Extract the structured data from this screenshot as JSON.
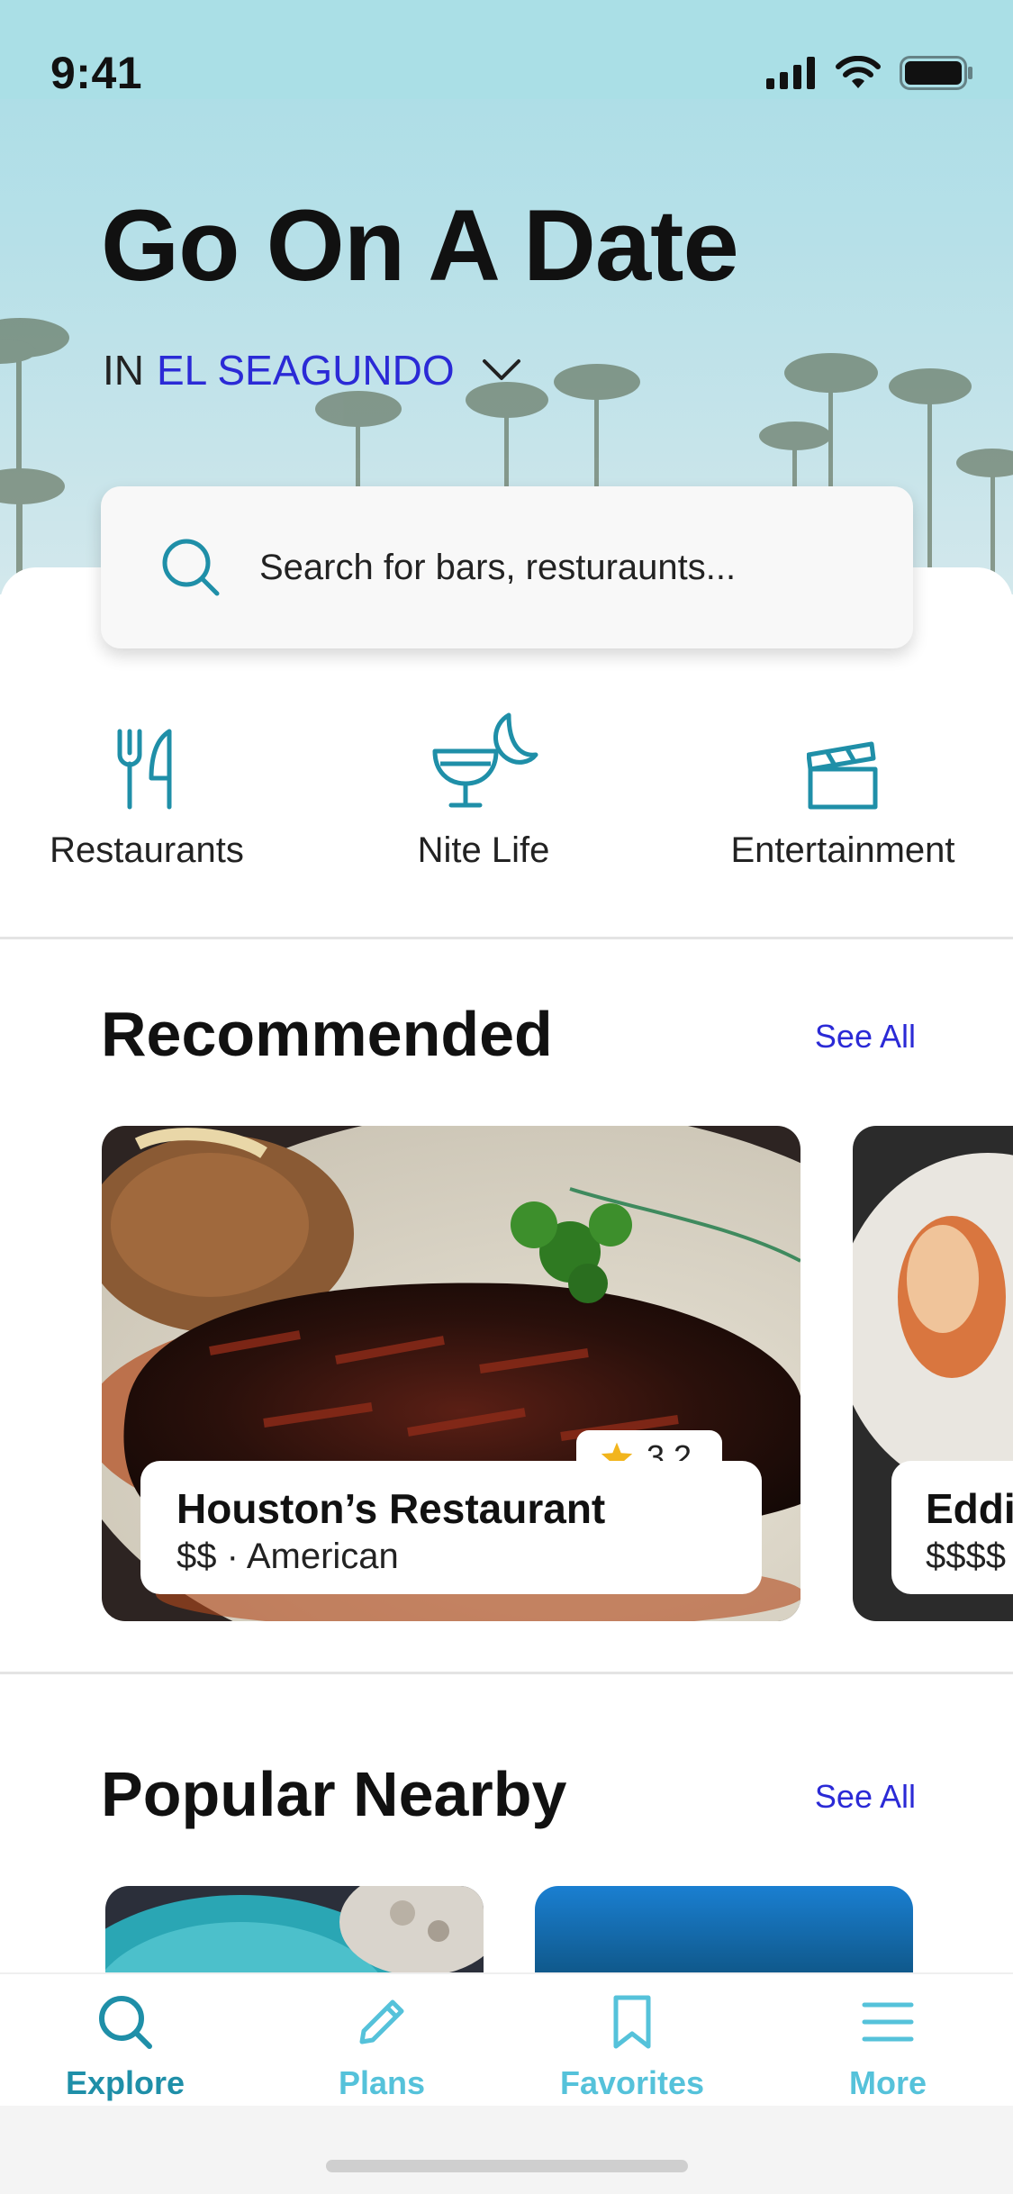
{
  "status_bar": {
    "time": "9:41"
  },
  "hero": {
    "title": "Go On A Date",
    "location_prefix": "IN",
    "location_city": "EL SEAGUNDO"
  },
  "search": {
    "placeholder": "Search for bars, resturaunts..."
  },
  "categories": [
    {
      "label": "Restaurants",
      "icon": "fork-knife-icon"
    },
    {
      "label": "Nite Life",
      "icon": "cocktail-moon-icon"
    },
    {
      "label": "Entertainment",
      "icon": "clapperboard-icon"
    }
  ],
  "recommended": {
    "title": "Recommended",
    "see_all": "See All",
    "cards": [
      {
        "name": "Houston’s Restaurant",
        "meta": "$$ · American",
        "rating": "3.2"
      },
      {
        "name": "Eddie",
        "meta": "$$$$"
      }
    ]
  },
  "popular": {
    "title": "Popular Nearby",
    "see_all": "See All"
  },
  "tabbar": {
    "tabs": [
      {
        "label": "Explore",
        "icon": "search-icon",
        "active": true
      },
      {
        "label": "Plans",
        "icon": "pencil-icon"
      },
      {
        "label": "Favorites",
        "icon": "bookmark-icon"
      },
      {
        "label": "More",
        "icon": "menu-icon"
      }
    ]
  },
  "colors": {
    "accent_teal": "#1f8fa8",
    "tab_inactive": "#55c2da",
    "link_blue": "#2b2ad6",
    "star": "#f2b51d"
  }
}
